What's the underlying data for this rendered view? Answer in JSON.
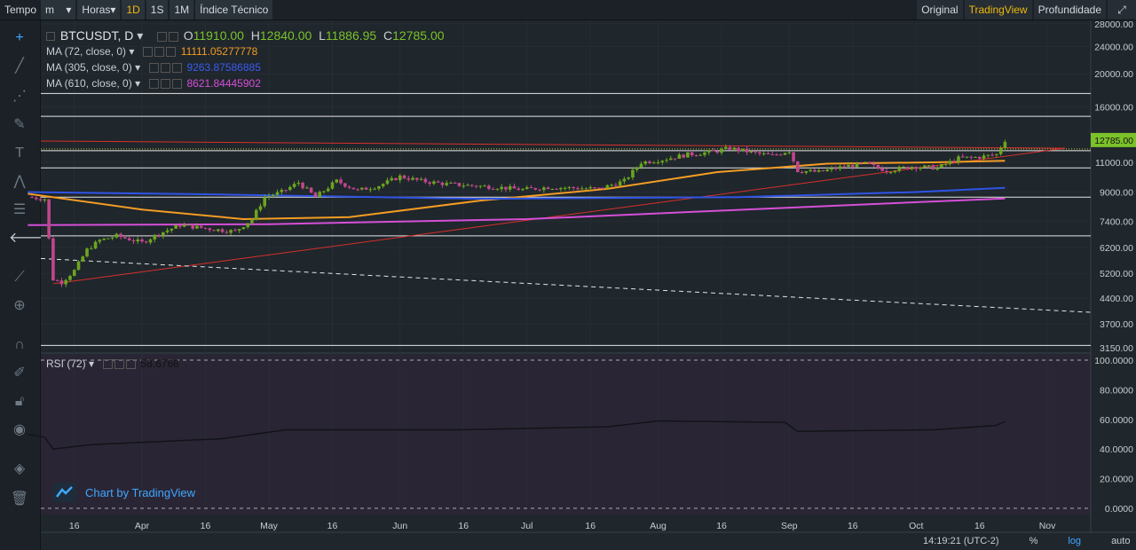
{
  "topbar": {
    "tempo": "Tempo",
    "minute_select": "m",
    "hours_select": "Horas",
    "intervals": [
      "1D",
      "1S",
      "1M"
    ],
    "active_interval": "1D",
    "indicators": "Índice Técnico",
    "views": [
      "Original",
      "TradingView",
      "Profundidade"
    ],
    "active_view": "TradingView"
  },
  "legend": {
    "symbol": "BTCUSDT, D",
    "o_label": "O",
    "o": "11910.00",
    "h_label": "H",
    "h": "12840.00",
    "l_label": "L",
    "l": "11886.95",
    "c_label": "C",
    "c": "12785.00",
    "ma72": "MA (72, close, 0)",
    "ma72_val": "11111.05277778",
    "ma305": "MA (305, close, 0)",
    "ma305_val": "9263.87586885",
    "ma610": "MA (610, close, 0)",
    "ma610_val": "8621.84445902",
    "rsi": "RSI (72)",
    "rsi_val": "58.6766"
  },
  "watermark": "Chart by TradingView",
  "bottom": {
    "time": "14:19:21 (UTC-2)",
    "pct": "%",
    "log": "log",
    "auto": "auto"
  },
  "colors": {
    "bg": "#1f262c",
    "rsi_bg": "#2a2535",
    "up": "#6ba520",
    "down": "#c2468c",
    "ma72": "#f39c24",
    "ma305": "#2f54e6",
    "ma610": "#d64fd8",
    "trend": "#d8302a",
    "price_tag": "#7bc22a"
  },
  "chart_data": {
    "type": "candlestick",
    "symbol": "BTCUSDT, D",
    "x_tick_labels": [
      "16",
      "Apr",
      "16",
      "May",
      "16",
      "Jun",
      "16",
      "Jul",
      "16",
      "Aug",
      "16",
      "Sep",
      "16",
      "Oct",
      "16",
      "Nov"
    ],
    "y_tick_labels": [
      "28000.00",
      "24000.00",
      "20000.00",
      "16000.00",
      "12785.00",
      "11000.00",
      "9000.00",
      "7400.00",
      "6200.00",
      "5200.00",
      "4400.00",
      "3700.00",
      "3150.00"
    ],
    "y_scale": "log",
    "last_price": 12785.0,
    "ohlc_last": {
      "open": 11910.0,
      "high": 12840.0,
      "low": 11886.95,
      "close": 12785.0
    },
    "horizontal_levels": [
      17500,
      15000,
      11900,
      10600,
      8700,
      6700,
      3200
    ],
    "price_path": [
      [
        "Mar 5",
        8700
      ],
      [
        "Mar 9",
        8600
      ],
      [
        "Mar 11",
        5000
      ],
      [
        "Mar 13",
        4900
      ],
      [
        "Mar 16",
        5300
      ],
      [
        "Mar 19",
        6100
      ],
      [
        "Mar 22",
        6500
      ],
      [
        "Mar 26",
        6700
      ],
      [
        "Apr 1",
        6400
      ],
      [
        "Apr 5",
        6800
      ],
      [
        "Apr 10",
        7200
      ],
      [
        "Apr 14",
        7100
      ],
      [
        "Apr 18",
        7000
      ],
      [
        "Apr 23",
        6900
      ],
      [
        "Apr 27",
        7500
      ],
      [
        "Apr 30",
        8700
      ],
      [
        "May 4",
        9000
      ],
      [
        "May 8",
        9600
      ],
      [
        "May 12",
        8700
      ],
      [
        "May 17",
        9700
      ],
      [
        "May 22",
        9100
      ],
      [
        "May 27",
        9400
      ],
      [
        "Jun 1",
        10000
      ],
      [
        "Jun 6",
        9700
      ],
      [
        "Jun 12",
        9500
      ],
      [
        "Jun 18",
        9400
      ],
      [
        "Jun 24",
        9300
      ],
      [
        "Jun 30",
        9150
      ],
      [
        "Jul 6",
        9300
      ],
      [
        "Jul 12",
        9250
      ],
      [
        "Jul 18",
        9200
      ],
      [
        "Jul 24",
        9700
      ],
      [
        "Jul 28",
        11000
      ],
      [
        "Aug 2",
        11200
      ],
      [
        "Aug 8",
        11600
      ],
      [
        "Aug 14",
        11800
      ],
      [
        "Aug 18",
        12100
      ],
      [
        "Aug 24",
        11700
      ],
      [
        "Aug 28",
        11500
      ],
      [
        "Sep 1",
        11900
      ],
      [
        "Sep 3",
        10400
      ],
      [
        "Sep 8",
        10300
      ],
      [
        "Sep 14",
        10700
      ],
      [
        "Sep 19",
        10900
      ],
      [
        "Sep 24",
        10400
      ],
      [
        "Sep 30",
        10700
      ],
      [
        "Oct 6",
        10600
      ],
      [
        "Oct 11",
        11300
      ],
      [
        "Oct 16",
        11400
      ],
      [
        "Oct 20",
        11600
      ],
      [
        "Oct 22",
        12785
      ]
    ],
    "series": [
      {
        "name": "MA (72, close, 0)",
        "last": 11111.05277778,
        "path": [
          [
            "Mar 5",
            8900
          ],
          [
            "Apr 1",
            8000
          ],
          [
            "Apr 25",
            7500
          ],
          [
            "May 20",
            7600
          ],
          [
            "Jun 20",
            8500
          ],
          [
            "Jul 20",
            9200
          ],
          [
            "Aug 15",
            10300
          ],
          [
            "Sep 10",
            10900
          ],
          [
            "Oct 5",
            11000
          ],
          [
            "Oct 22",
            11111
          ]
        ]
      },
      {
        "name": "MA (305, close, 0)",
        "last": 9263.87586885,
        "path": [
          [
            "Mar 5",
            9000
          ],
          [
            "Apr 20",
            8850
          ],
          [
            "Jun 20",
            8600
          ],
          [
            "Aug 20",
            8700
          ],
          [
            "Oct 1",
            9000
          ],
          [
            "Oct 22",
            9264
          ]
        ]
      },
      {
        "name": "MA (610, close, 0)",
        "last": 8621.84445902,
        "path": [
          [
            "Mar 5",
            7200
          ],
          [
            "May 1",
            7250
          ],
          [
            "Jul 1",
            7500
          ],
          [
            "Sep 1",
            8100
          ],
          [
            "Oct 22",
            8622
          ]
        ]
      },
      {
        "name": "RSI (72)",
        "last": 58.6766,
        "path": [
          [
            "Mar 5",
            50
          ],
          [
            "Mar 9",
            48
          ],
          [
            "Mar 11",
            40
          ],
          [
            "Mar 20",
            43
          ],
          [
            "Apr 20",
            47
          ],
          [
            "May 5",
            53
          ],
          [
            "Jun 15",
            53
          ],
          [
            "Jul 20",
            55
          ],
          [
            "Aug 1",
            59
          ],
          [
            "Aug 31",
            58
          ],
          [
            "Sep 3",
            52
          ],
          [
            "Oct 5",
            53
          ],
          [
            "Oct 20",
            56
          ],
          [
            "Oct 22",
            58.7
          ]
        ]
      }
    ],
    "rsi_y_tick_labels": [
      "100.0000",
      "80.0000",
      "60.0000",
      "40.0000",
      "20.0000",
      "0.0000"
    ]
  }
}
